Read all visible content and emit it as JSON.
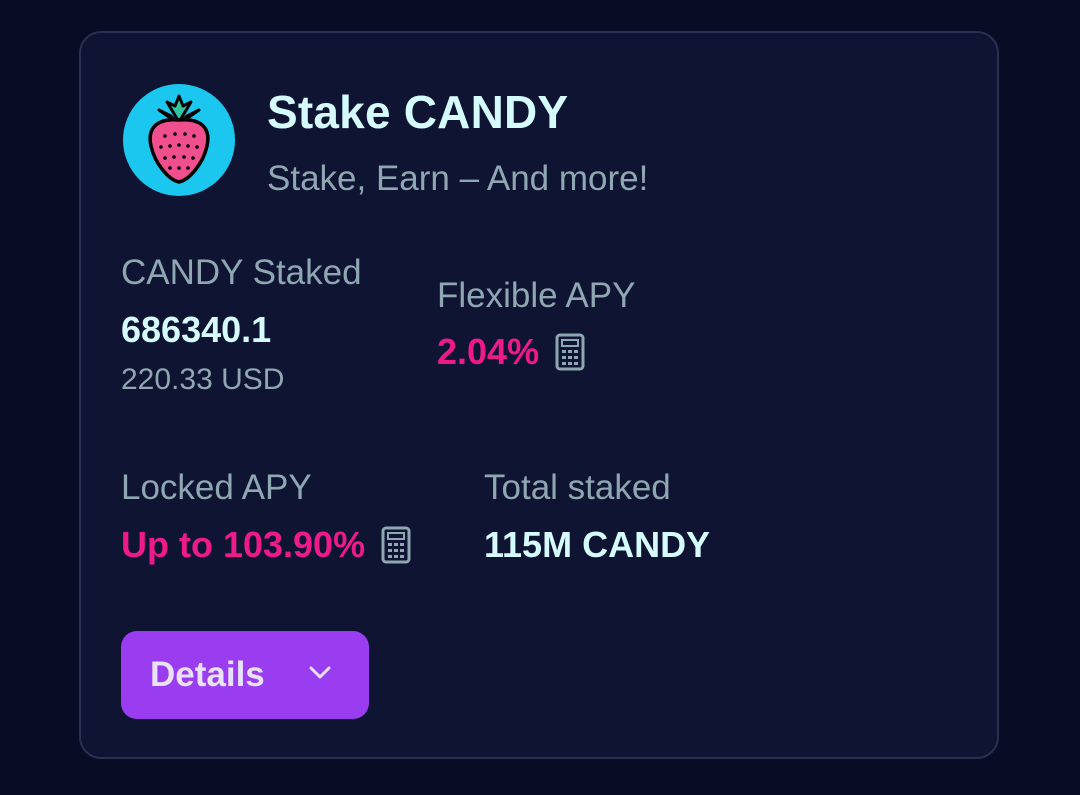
{
  "pool": {
    "title": "Stake CANDY",
    "subtitle": "Stake, Earn – And more!",
    "logo_icon": "strawberry-icon"
  },
  "stats": {
    "staked_label": "CANDY Staked",
    "staked_value": "686340.1",
    "staked_usd": "220.33 USD",
    "flexible_label": "Flexible APY",
    "flexible_value": "2.04%",
    "locked_label": "Locked APY",
    "locked_value": "Up to 103.90%",
    "total_label": "Total staked",
    "total_value": "115M CANDY",
    "calculator_icon": "calculator-icon"
  },
  "actions": {
    "details_label": "Details",
    "details_icon": "chevron-down-icon"
  },
  "colors": {
    "background": "#080c24",
    "card": "#0e1431",
    "accent_pink": "#ee1a8a",
    "button_purple": "#9a3df0",
    "text_light": "#d6fbff",
    "text_muted": "#8fa6b3"
  }
}
